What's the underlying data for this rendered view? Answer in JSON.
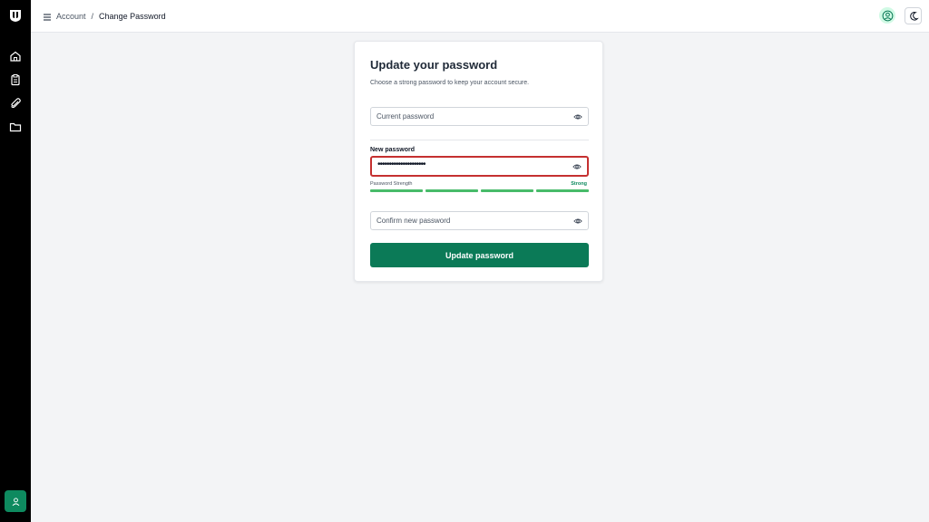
{
  "header": {
    "breadcrumb": [
      "Account",
      "/",
      "Change Password"
    ]
  },
  "sidebar": {
    "icons": [
      "home-icon",
      "clipboard-icon",
      "paperclip-icon",
      "folder-icon"
    ],
    "user_icon": "user-icon"
  },
  "card": {
    "title": "Update your password",
    "subtitle": "Choose a strong password to keep your account secure.",
    "current_password_placeholder": "Current password",
    "new_password_label": "New password",
    "new_password_value": "•••••••••••••••••••••",
    "strength_label": "Password Strength",
    "strength_value": "Strong",
    "strength_level": 4,
    "strength_max": 4,
    "confirm_password_placeholder": "Confirm new password",
    "submit_label": "Update password"
  },
  "colors": {
    "accent": "#0b7a57",
    "error_border": "#c53030",
    "strength_bar": "#48bb6a"
  }
}
